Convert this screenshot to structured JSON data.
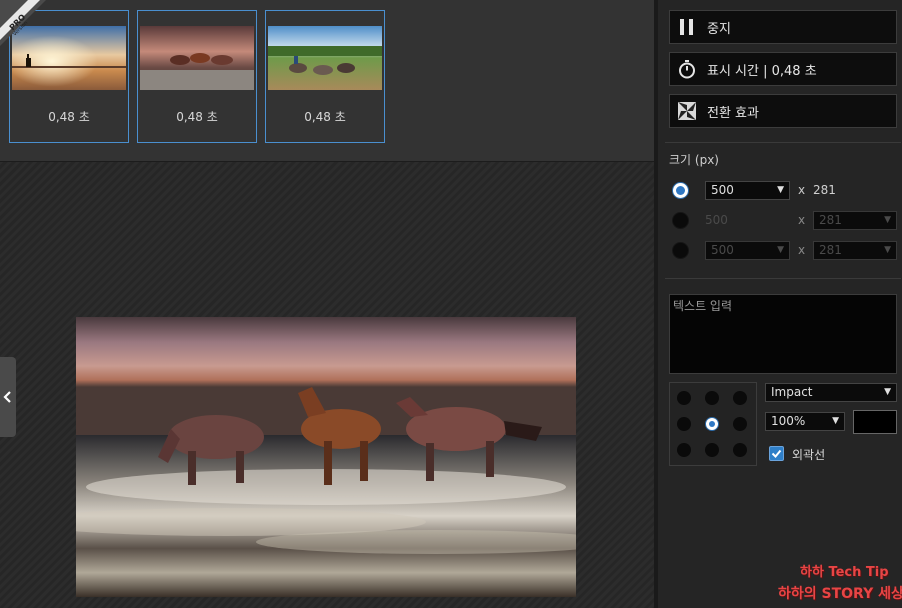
{
  "badge": {
    "pro": "PRO",
    "version": "Version"
  },
  "thumbnails": [
    {
      "duration": "0,48 초",
      "scene": "sunset-rider"
    },
    {
      "duration": "0,48 초",
      "scene": "horses-waves"
    },
    {
      "duration": "0,48 초",
      "scene": "horses-field"
    }
  ],
  "panel": {
    "stop_label": "중지",
    "display_time_label": "표시 시간 | 0,48 초",
    "transition_label": "전환 효과",
    "size_label": "크기 (px)",
    "size_rows": [
      {
        "width": "500",
        "height": "281",
        "active": true
      },
      {
        "width": "500",
        "height": "281",
        "active": false
      },
      {
        "width": "500",
        "height": "281",
        "active": false
      }
    ],
    "times_sign": "x",
    "text_placeholder": "텍스트 입력",
    "font": "Impact",
    "font_size": "100%",
    "outline_label": "외곽선",
    "outline_checked": true,
    "position_selected": "center"
  },
  "watermark": {
    "line1": "하하 Tech Tip",
    "line2": "하하의 STORY 세상"
  },
  "colors": {
    "accent": "#2f78c4",
    "panel_bg": "#252525",
    "button_bg": "#0d0d0d",
    "thumb_border": "#4a8fcf"
  },
  "icons": {
    "stop": "pause-icon",
    "timer": "stopwatch-icon",
    "transition": "transition-icon",
    "collapse": "chevron-left-icon"
  }
}
